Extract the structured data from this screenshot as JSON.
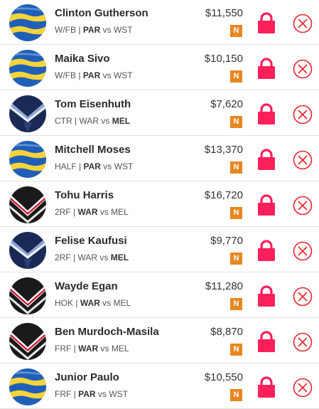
{
  "colors": {
    "lock": "#ff1f5a",
    "remove": "#e8252e",
    "badge": "#e8861f",
    "eels_blue": "#1f5fb8",
    "eels_gold": "#f5d33a",
    "storm_navy": "#1b2a55",
    "storm_accent": "#8fa5d8",
    "warriors_black": "#1a1a1a",
    "warriors_red": "#c8102e"
  },
  "players": [
    {
      "name": "Clinton Gutherson",
      "position": "W/FB",
      "team": "PAR",
      "vs": "vs",
      "opp": "WST",
      "bold": "team",
      "price": "$11,550",
      "badge": "N",
      "club_logo": "eels-logo"
    },
    {
      "name": "Maika Sivo",
      "position": "W/FB",
      "team": "PAR",
      "vs": "vs",
      "opp": "WST",
      "bold": "team",
      "price": "$10,150",
      "badge": "N",
      "club_logo": "eels-logo"
    },
    {
      "name": "Tom Eisenhuth",
      "position": "CTR",
      "team": "WAR",
      "vs": "vs",
      "opp": "MEL",
      "bold": "opp",
      "price": "$7,620",
      "badge": "N",
      "club_logo": "storm-logo"
    },
    {
      "name": "Mitchell Moses",
      "position": "HALF",
      "team": "PAR",
      "vs": "vs",
      "opp": "WST",
      "bold": "team",
      "price": "$13,370",
      "badge": "N",
      "club_logo": "eels-logo"
    },
    {
      "name": "Tohu Harris",
      "position": "2RF",
      "team": "WAR",
      "vs": "vs",
      "opp": "MEL",
      "bold": "team",
      "price": "$16,720",
      "badge": "N",
      "club_logo": "warriors-logo"
    },
    {
      "name": "Felise Kaufusi",
      "position": "2RF",
      "team": "WAR",
      "vs": "vs",
      "opp": "MEL",
      "bold": "opp",
      "price": "$9,770",
      "badge": "N",
      "club_logo": "storm-logo"
    },
    {
      "name": "Wayde Egan",
      "position": "HOK",
      "team": "WAR",
      "vs": "vs",
      "opp": "MEL",
      "bold": "team",
      "price": "$11,280",
      "badge": "N",
      "club_logo": "warriors-logo"
    },
    {
      "name": "Ben Murdoch-Masila",
      "position": "FRF",
      "team": "WAR",
      "vs": "vs",
      "opp": "MEL",
      "bold": "team",
      "price": "$8,870",
      "badge": "N",
      "club_logo": "warriors-logo"
    },
    {
      "name": "Junior Paulo",
      "position": "FRF",
      "team": "PAR",
      "vs": "vs",
      "opp": "WST",
      "bold": "team",
      "price": "$10,550",
      "badge": "N",
      "club_logo": "eels-logo"
    }
  ],
  "separator": "|"
}
